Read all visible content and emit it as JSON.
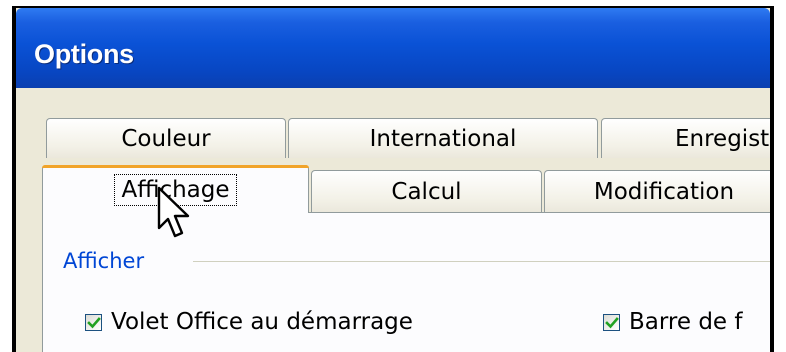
{
  "window": {
    "title": "Options"
  },
  "tabs_row1": [
    {
      "label": "Couleur"
    },
    {
      "label": "International"
    },
    {
      "label": "Enregist"
    }
  ],
  "tabs_row2": [
    {
      "label": "Affichage",
      "selected": true
    },
    {
      "label": "Calcul"
    },
    {
      "label": "Modification"
    }
  ],
  "group": {
    "label": "Afficher"
  },
  "checkboxes": [
    {
      "label": "Volet Office au démarrage",
      "checked": true
    },
    {
      "label": "Barre de f",
      "checked": true
    }
  ],
  "colors": {
    "title_bar": "#0a52d6",
    "accent_tab": "#f1a42a",
    "group_label": "#0046d5",
    "check": "#21a121"
  },
  "icons": {
    "checkmark": "checkmark-icon",
    "cursor": "mouse-pointer-icon"
  }
}
